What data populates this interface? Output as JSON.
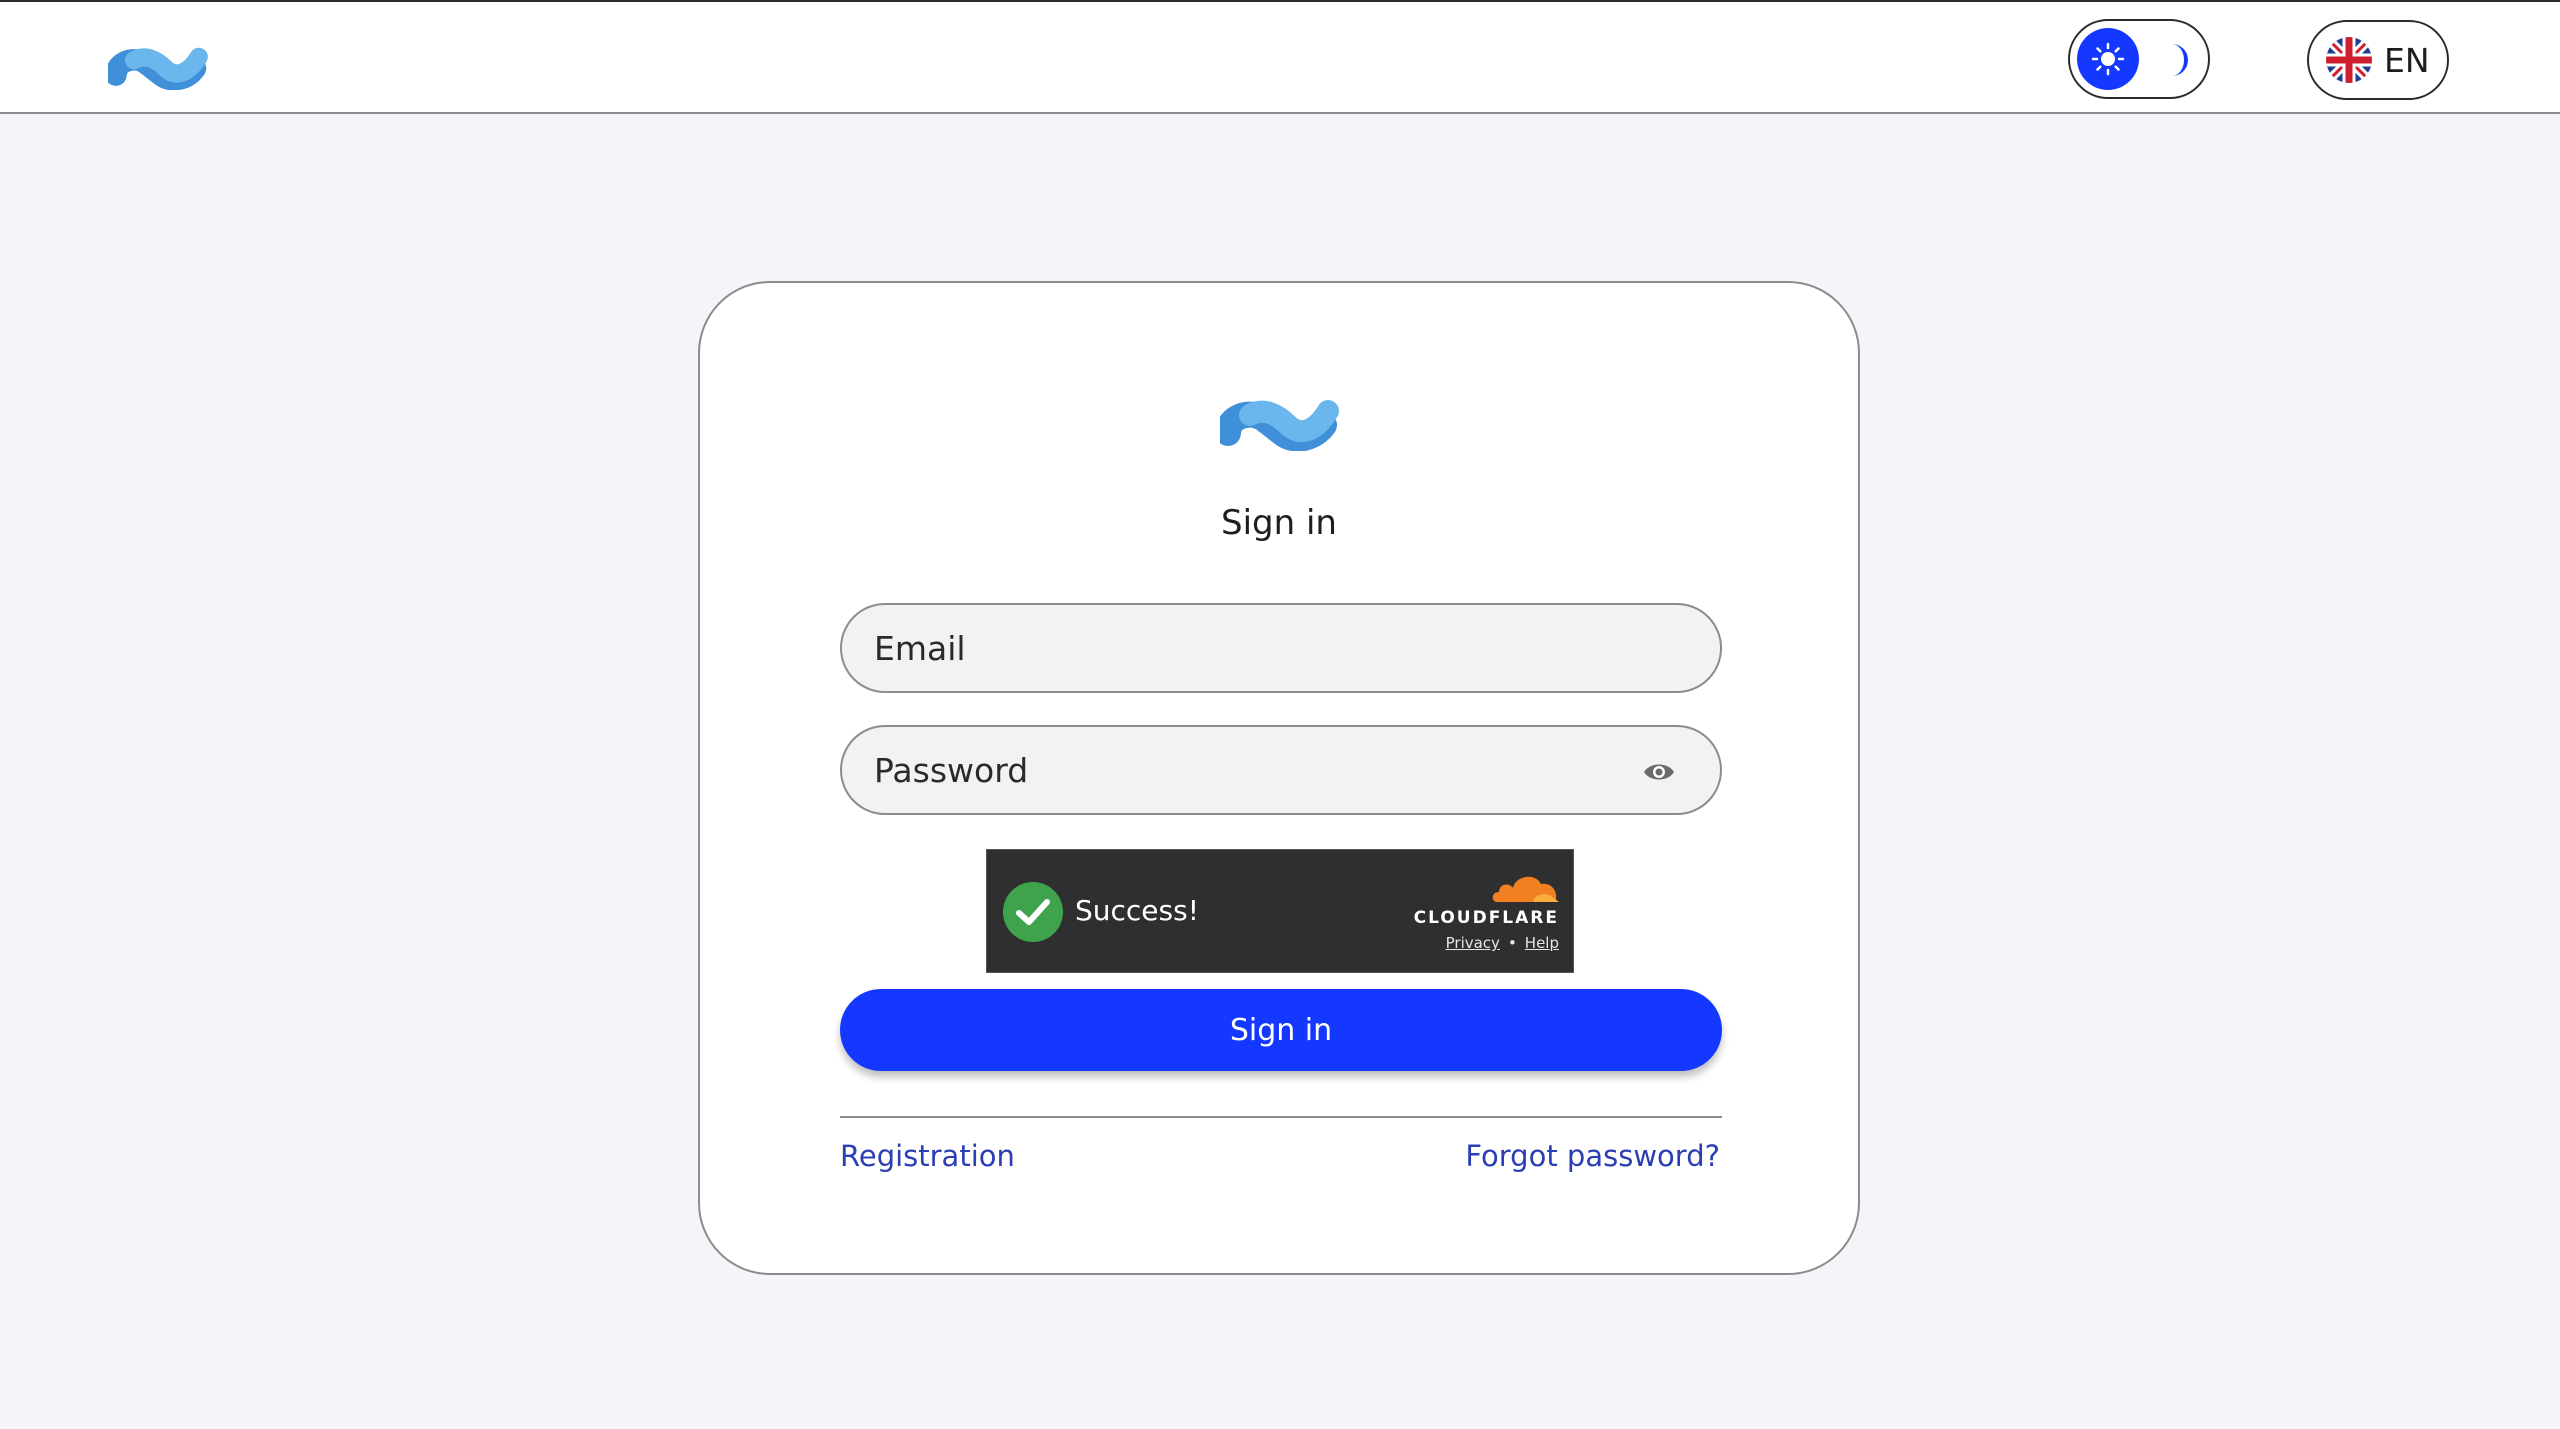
{
  "header": {
    "logo_icon": "brand-wave-logo",
    "theme_toggle": {
      "light_icon": "sun-icon",
      "dark_icon": "moon-icon",
      "active": "light"
    },
    "language": {
      "flag_icon": "uk-flag-icon",
      "label": "EN"
    }
  },
  "card": {
    "logo_icon": "brand-wave-logo",
    "title": "Sign in",
    "email": {
      "value": "",
      "placeholder": "Email"
    },
    "password": {
      "value": "",
      "placeholder": "Password",
      "toggle_icon": "eye-icon"
    },
    "captcha": {
      "status_icon": "check-circle-icon",
      "status_text": "Success!",
      "provider": "CLOUDFLARE",
      "privacy_label": "Privacy",
      "separator": "•",
      "help_label": "Help"
    },
    "submit_label": "Sign in",
    "registration_label": "Registration",
    "forgot_label": "Forgot password?"
  },
  "colors": {
    "accent": "#1438ff",
    "link": "#2b3eb3",
    "background": "#f4f4f9",
    "success": "#3fa34d",
    "cloudflare": "#f38020"
  }
}
